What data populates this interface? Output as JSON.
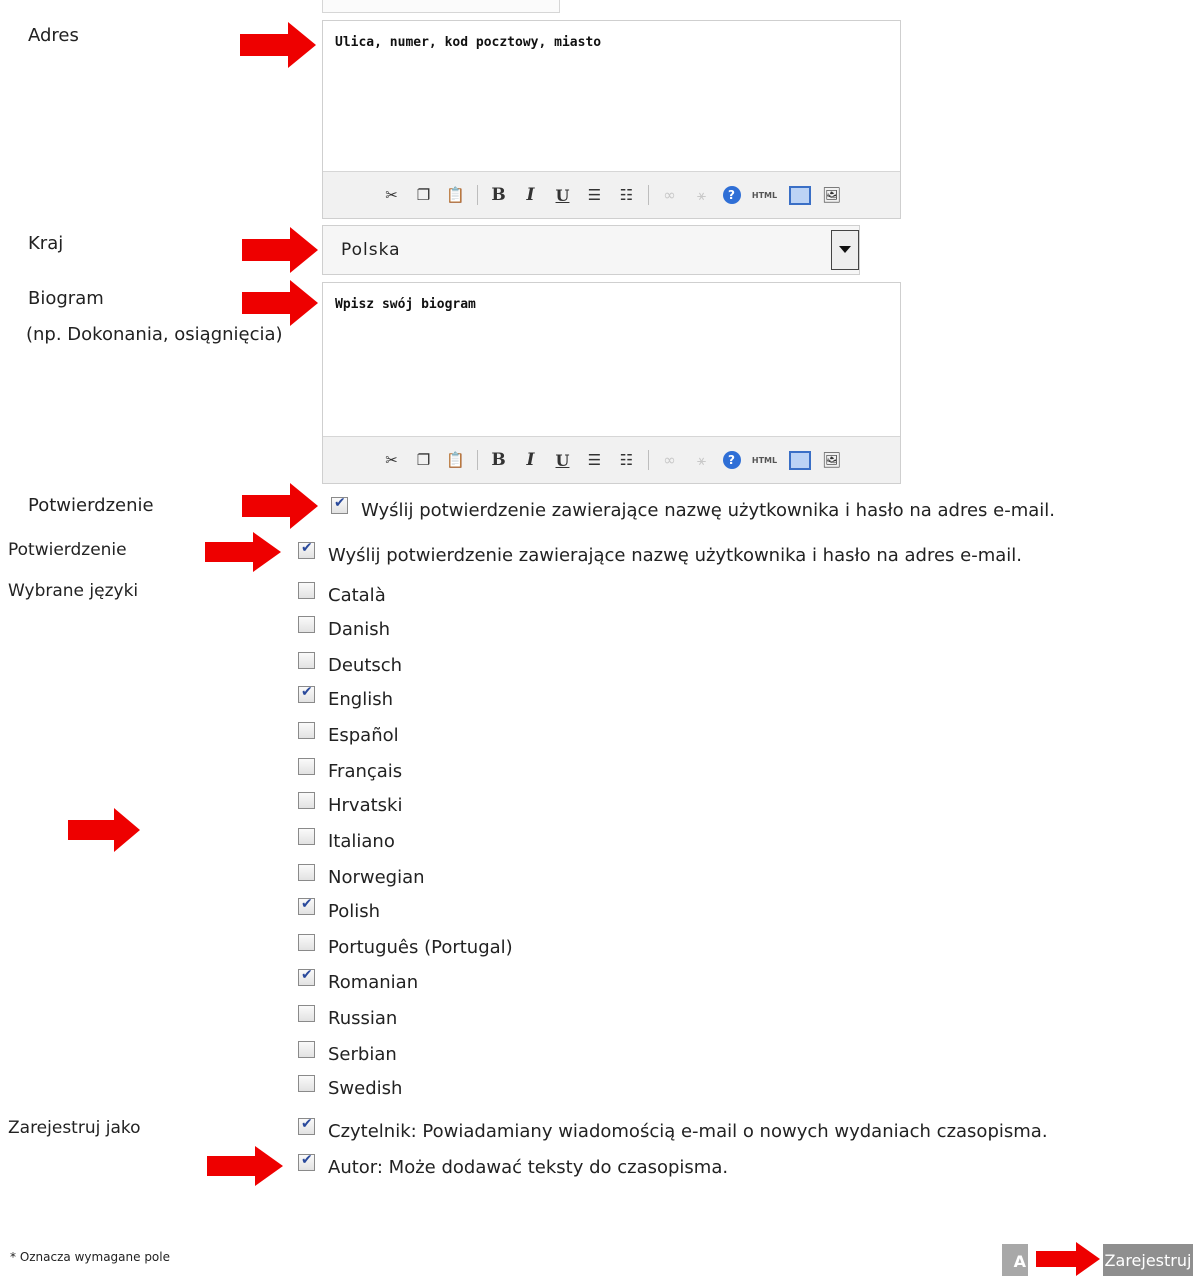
{
  "labels": {
    "adres": "Adres",
    "kraj": "Kraj",
    "biogram": "Biogram",
    "biogram_hint": "(np. Dokonania, osiągnięcia)",
    "potwierdzenie1": "Potwierdzenie",
    "potwierdzenie2": "Potwierdzenie",
    "jezyki": "Wybrane języki",
    "rejestruj_jako": "Zarejestruj jako"
  },
  "adres_editor": {
    "text": "Ulica, numer, kod pocztowy, miasto"
  },
  "kraj_select": {
    "value": "Polska"
  },
  "biogram_editor": {
    "text": "Wpisz swój biogram"
  },
  "toolbar_icons": [
    "cut-icon",
    "copy-icon",
    "paste-icon",
    "bold-icon",
    "italic-icon",
    "underline-icon",
    "bullet-list-icon",
    "numbered-list-icon",
    "link-icon",
    "unlink-icon",
    "help-icon",
    "html-icon",
    "fullscreen-icon",
    "image-icon"
  ],
  "confirm1": {
    "text": "Wyślij potwierdzenie zawierające nazwę użytkownika i hasło na adres e-mail.",
    "checked": true
  },
  "confirm2": {
    "text": "Wyślij potwierdzenie zawierające nazwę użytkownika i hasło na adres e-mail.",
    "checked": true
  },
  "languages": [
    {
      "name": "Català",
      "checked": false
    },
    {
      "name": "Danish",
      "checked": false
    },
    {
      "name": "Deutsch",
      "checked": false
    },
    {
      "name": "English",
      "checked": true
    },
    {
      "name": "Español",
      "checked": false
    },
    {
      "name": "Français",
      "checked": false
    },
    {
      "name": "Hrvatski",
      "checked": false
    },
    {
      "name": "Italiano",
      "checked": false
    },
    {
      "name": "Norwegian",
      "checked": false
    },
    {
      "name": "Polish",
      "checked": true
    },
    {
      "name": "Português (Portugal)",
      "checked": false
    },
    {
      "name": "Romanian",
      "checked": true
    },
    {
      "name": "Russian",
      "checked": false
    },
    {
      "name": "Serbian",
      "checked": false
    },
    {
      "name": "Swedish",
      "checked": false
    }
  ],
  "roles": [
    {
      "text": "Czytelnik: Powiadamiany wiadomością e-mail o nowych wydaniach czasopisma.",
      "checked": true
    },
    {
      "text": "Autor: Może dodawać teksty do czasopisma.",
      "checked": true
    }
  ],
  "footer": {
    "required_note": "* Oznacza wymagane pole",
    "cancel_label": "A",
    "submit_label": "Zarejestruj"
  },
  "colors": {
    "arrow": "#ee0000",
    "check": "#2a4a9c"
  }
}
